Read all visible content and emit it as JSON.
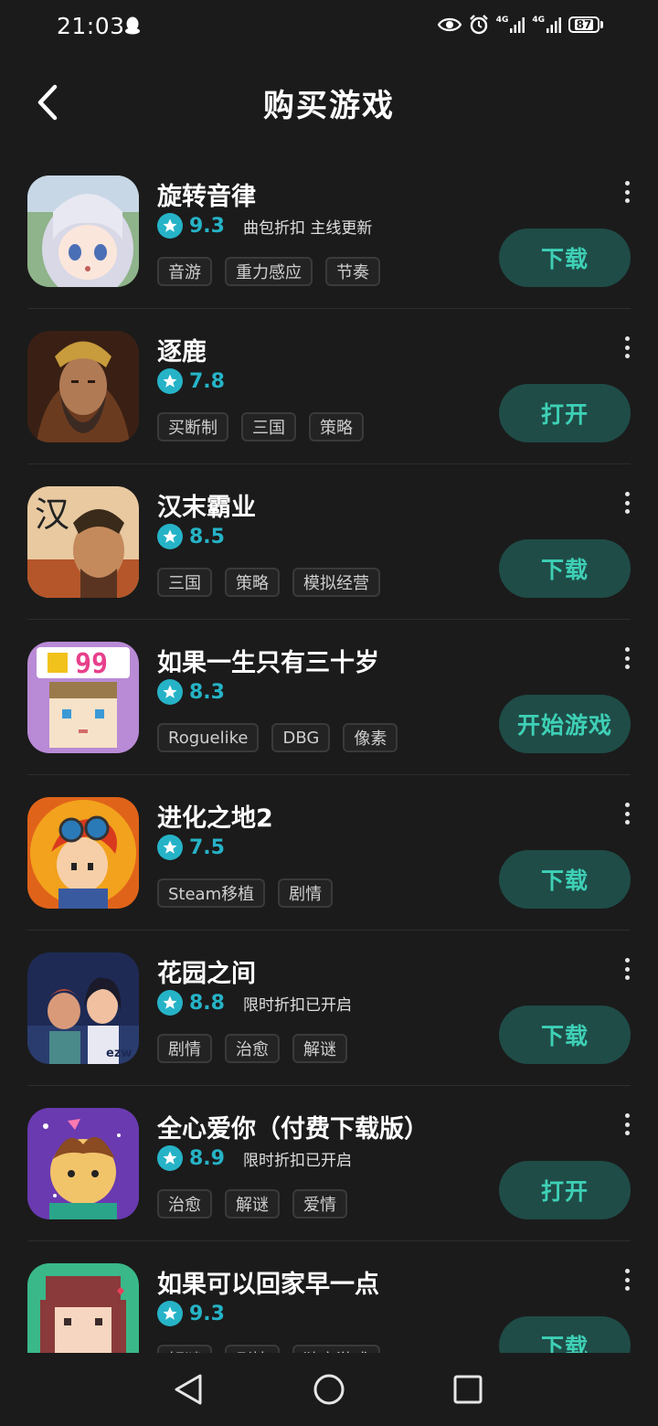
{
  "status_bar": {
    "time": "21:03",
    "network_1": "4G",
    "network_2": "4G",
    "battery": "87"
  },
  "header": {
    "title": "购买游戏"
  },
  "games": [
    {
      "name": "旋转音律",
      "rating": "9.3",
      "promo": "曲包折扣 主线更新",
      "tags": [
        "音游",
        "重力感应",
        "节奏"
      ],
      "action": "下载"
    },
    {
      "name": "逐鹿",
      "rating": "7.8",
      "promo": "",
      "tags": [
        "买断制",
        "三国",
        "策略"
      ],
      "action": "打开"
    },
    {
      "name": "汉末霸业",
      "rating": "8.5",
      "promo": "",
      "tags": [
        "三国",
        "策略",
        "模拟经营"
      ],
      "action": "下载"
    },
    {
      "name": "如果一生只有三十岁",
      "rating": "8.3",
      "promo": "",
      "tags": [
        "Roguelike",
        "DBG",
        "像素"
      ],
      "action": "开始游戏"
    },
    {
      "name": "进化之地2",
      "rating": "7.5",
      "promo": "",
      "tags": [
        "Steam移植",
        "剧情"
      ],
      "action": "下载"
    },
    {
      "name": "花园之间",
      "rating": "8.8",
      "promo": "限时折扣已开启",
      "tags": [
        "剧情",
        "治愈",
        "解谜"
      ],
      "action": "下载"
    },
    {
      "name": "全心爱你（付费下载版）",
      "rating": "8.9",
      "promo": "限时折扣已开启",
      "tags": [
        "治愈",
        "解谜",
        "爱情"
      ],
      "action": "打开"
    },
    {
      "name": "如果可以回家早一点",
      "rating": "9.3",
      "promo": "",
      "tags": [
        "解谜",
        "剧情",
        "独立游戏"
      ],
      "action": "下载"
    }
  ],
  "icon_art": {
    "game0": {
      "text": ""
    },
    "game2": {
      "text": "汉"
    },
    "game3": {
      "text": "99"
    },
    "game5": {
      "text": "ezw"
    }
  },
  "icons": {
    "back": "chevron-left-icon",
    "star": "star-icon",
    "more": "more-vertical-icon",
    "nav_back": "triangle-back-icon",
    "nav_home": "circle-home-icon",
    "nav_recent": "square-recent-icon"
  },
  "colors": {
    "background": "#1b1b1b",
    "accent": "#26b3c7",
    "button_bg": "#1f4c47",
    "button_text": "#3ed0b6"
  }
}
